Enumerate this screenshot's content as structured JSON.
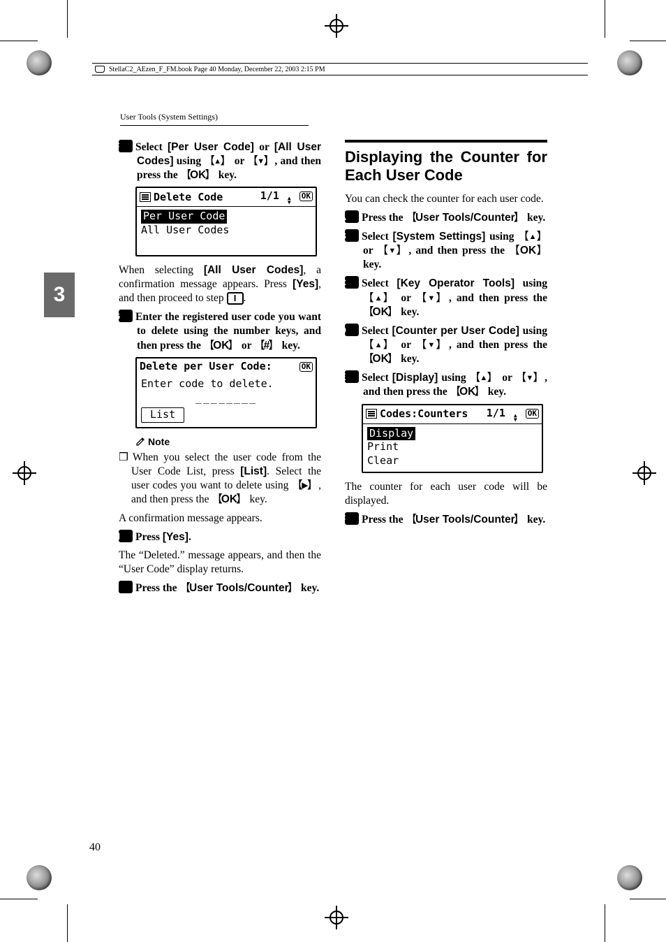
{
  "book_footer": "StellaC2_AEzen_F_FM.book  Page 40  Monday, December 22, 2003  2:15 PM",
  "running_head": "User Tools (System Settings)",
  "side_tab": "3",
  "page_number": "40",
  "left": {
    "step6": {
      "num": "F",
      "pre": "Select ",
      "opt1": "[Per User Code]",
      "mid1": " or ",
      "opt2": "[All User Codes]",
      "mid2": " using ",
      "up": "U",
      "or": " or ",
      "down": "V",
      "tail1": ", and then press the ",
      "ok": "OK",
      "tail2": " key."
    },
    "lcd1": {
      "title": "Delete Code",
      "page": "1/1",
      "ok": "OK",
      "row_sel": "Per User Code",
      "row2": "All User Codes"
    },
    "after6_a": "When selecting ",
    "after6_opt": "[All User Codes]",
    "after6_b": ", a confirmation message appears. Press ",
    "after6_yes": "[Yes]",
    "after6_c": ", and then proceed to step ",
    "after6_stepref": "I",
    "after6_d": ".",
    "step7": {
      "num": "G",
      "text_a": "Enter the registered user code you want to delete using the number keys, and then press the ",
      "ok": "OK",
      "or": " or ",
      "hash": "#",
      "tail": " key."
    },
    "lcd2": {
      "title": "Delete per User Code:",
      "ok": "OK",
      "line1": "Enter code to delete.",
      "input": "________",
      "softkey": "List"
    },
    "note_label": "Note",
    "note_bullet_a": "When you select the user code from the User Code List, press ",
    "note_list": "[List]",
    "note_bullet_b": ". Select the user codes you want to delete using ",
    "note_right": "W",
    "note_bullet_c": ", and then press the ",
    "note_ok": "OK",
    "note_bullet_d": " key.",
    "note_tail": "A confirmation message appears.",
    "step8": {
      "num": "H",
      "pre": "Press ",
      "yes": "[Yes]",
      "post": "."
    },
    "after8": "The “Deleted.” message appears, and then the “User Code” display returns.",
    "step9": {
      "num": "I",
      "pre": "Press the ",
      "key": "User Tools/Counter",
      "post": " key."
    }
  },
  "right": {
    "heading": "Displaying the Counter for Each User Code",
    "intro": "You can check the counter for each user code.",
    "step1": {
      "num": "A",
      "pre": "Press the ",
      "key": "User Tools/Counter",
      "post": " key."
    },
    "step2": {
      "num": "B",
      "pre": "Select ",
      "opt": "[System Settings]",
      "mid": " using ",
      "up": "U",
      "or": " or ",
      "down": "V",
      "tail1": ", and then press the ",
      "ok": "OK",
      "tail2": " key."
    },
    "step3": {
      "num": "C",
      "pre": "Select ",
      "opt": "[Key Operator Tools]",
      "mid": " using ",
      "up": "U",
      "or": " or ",
      "down": "V",
      "tail1": ", and then press the ",
      "ok": "OK",
      "tail2": " key."
    },
    "step4": {
      "num": "D",
      "pre": "Select ",
      "opt": "[Counter per User Code]",
      "mid": " using ",
      "up": "U",
      "or": " or ",
      "down": "V",
      "tail1": ", and then press the ",
      "ok": "OK",
      "tail2": " key."
    },
    "step5": {
      "num": "E",
      "pre": "Select ",
      "opt": "[Display]",
      "mid": " using ",
      "up": "U",
      "or": " or ",
      "down": "V",
      "tail1": ", and then press the ",
      "ok": "OK",
      "tail2": " key."
    },
    "lcd": {
      "title": "Codes:Counters",
      "page": "1/1",
      "ok": "OK",
      "row_sel": "Display",
      "row2": "Print",
      "row3": "Clear"
    },
    "after5": "The counter for each user code will be displayed.",
    "step6": {
      "num": "F",
      "pre": "Press the ",
      "key": "User Tools/Counter",
      "post": " key."
    }
  }
}
